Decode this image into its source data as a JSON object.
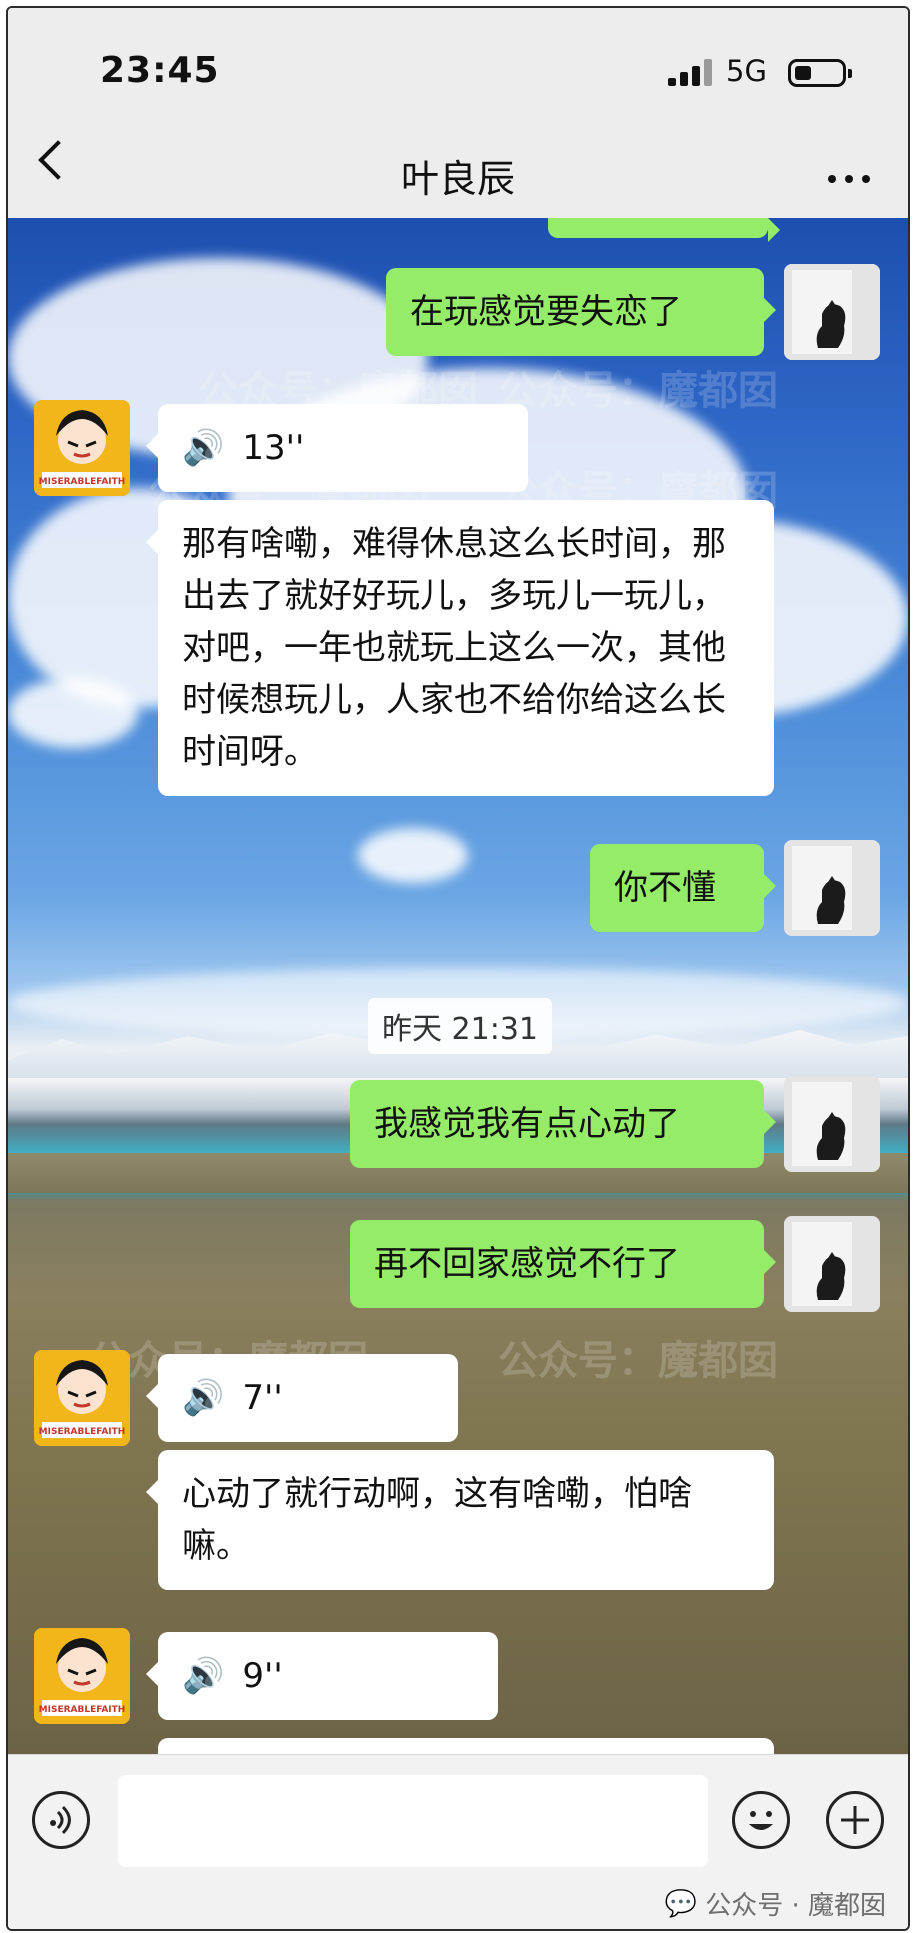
{
  "status_bar": {
    "time": "23:45",
    "network": "5G"
  },
  "header": {
    "title": "叶良辰"
  },
  "peer_avatar_text": "MISERABLEFAITH",
  "messages": {
    "m1": "在玩感觉要失恋了",
    "v1": "13''",
    "m2": "那有啥嘞，难得休息这么长时间，那出去了就好好玩儿，多玩儿一玩儿，对吧，一年也就玩上这么一次，其他时候想玩儿，人家也不给你给这么长时间呀。",
    "m3": "你不懂",
    "timestamp": "昨天 21:31",
    "m4": "我感觉我有点心动了",
    "m5": "再不回家感觉不行了",
    "v2": "7''",
    "m6": "心动了就行动啊，这有啥嘞，怕啥嘛。",
    "v3": "9''"
  },
  "watermark": "公众号：魔都囡",
  "footer_note": "公众号 · 魔都囡"
}
